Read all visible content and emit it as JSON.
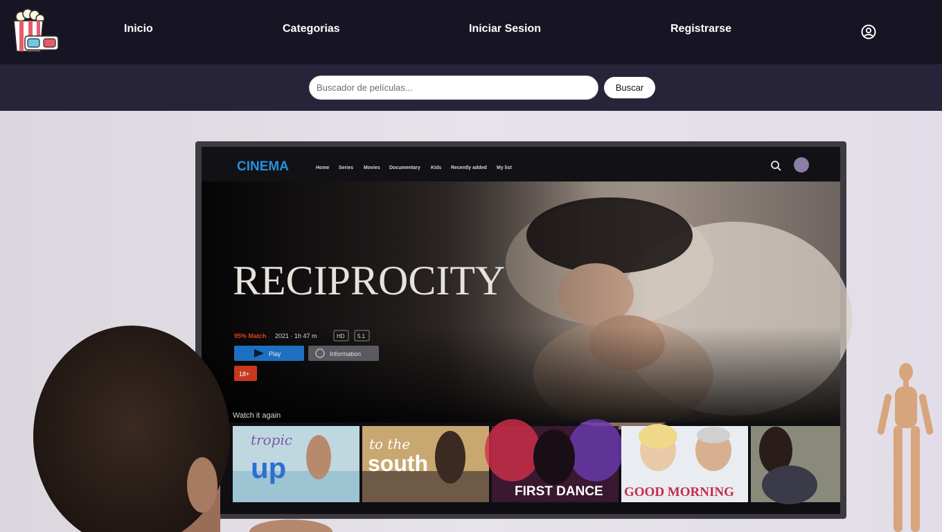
{
  "nav": {
    "links": [
      {
        "label": "Inicio"
      },
      {
        "label": "Categorias"
      },
      {
        "label": "Iniciar Sesion"
      },
      {
        "label": "Registrarse"
      }
    ],
    "logo_icon": "popcorn-3d-glasses-icon",
    "user_icon": "user-circle-icon"
  },
  "search": {
    "placeholder": "Buscador de películas...",
    "value": "",
    "button_label": "Buscar"
  },
  "hero": {
    "tv": {
      "brand": "CINEMA",
      "menu": [
        "Home",
        "Series",
        "Movies",
        "Documentary",
        "Kids",
        "Recently added",
        "My list"
      ],
      "featured_title": "RECIPROCITY",
      "match": "95% Match",
      "meta": "2021 · 1h 47 m",
      "badges": [
        "HD",
        "5.1"
      ],
      "play_label": "Play",
      "info_label": "Information",
      "rating": "18+",
      "row_title": "Watch it again",
      "thumbnails": [
        {
          "title_lines": [
            "tropic",
            "up"
          ]
        },
        {
          "title_lines": [
            "to the",
            "south"
          ]
        },
        {
          "title_lines": [
            "FIRST DANCE"
          ]
        },
        {
          "title_lines": [
            "GOOD MORNING"
          ]
        },
        {
          "title_lines": []
        }
      ]
    },
    "colors": {
      "accent_blue": "#1e6fc0",
      "match_red": "#d9412a",
      "rating_red": "#c8371e",
      "nav_bg": "#171524",
      "search_bg": "#27243a"
    }
  }
}
